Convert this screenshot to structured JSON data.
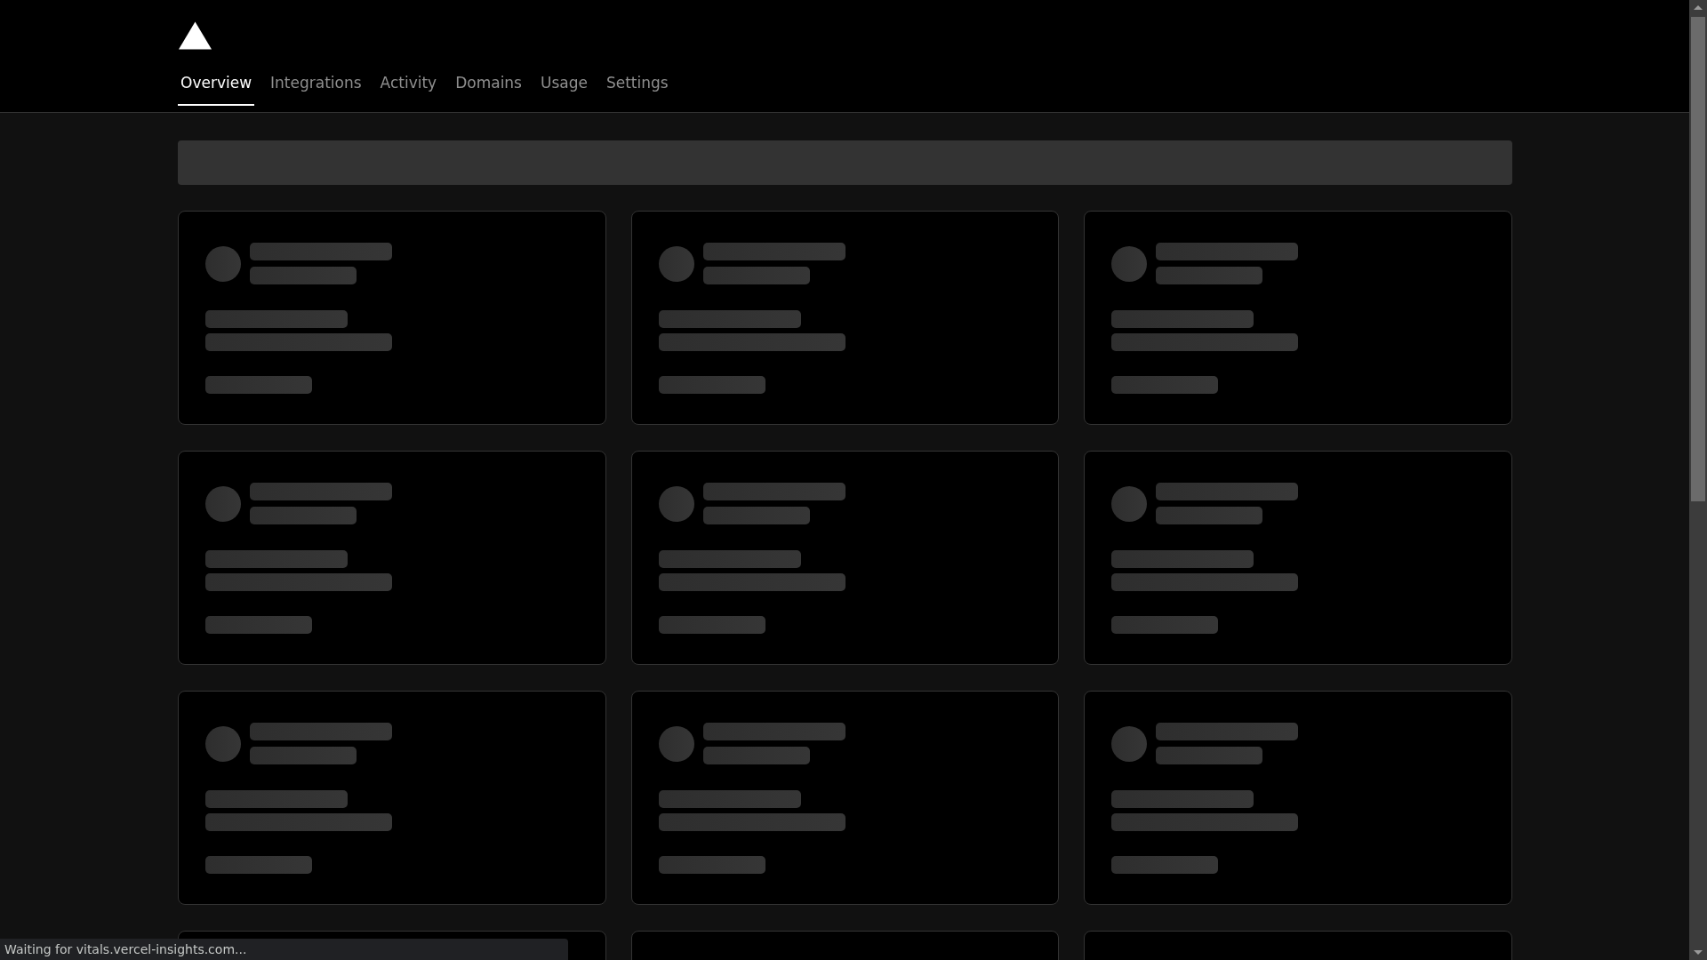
{
  "nav": {
    "tabs": [
      {
        "label": "Overview",
        "selected": true
      },
      {
        "label": "Integrations",
        "selected": false
      },
      {
        "label": "Activity",
        "selected": false
      },
      {
        "label": "Domains",
        "selected": false
      },
      {
        "label": "Usage",
        "selected": false
      },
      {
        "label": "Settings",
        "selected": false
      }
    ]
  },
  "search": {
    "kind": "skeleton"
  },
  "cards": [
    {
      "kind": "skeleton"
    },
    {
      "kind": "skeleton"
    },
    {
      "kind": "skeleton"
    },
    {
      "kind": "skeleton"
    },
    {
      "kind": "skeleton"
    },
    {
      "kind": "skeleton"
    },
    {
      "kind": "skeleton"
    },
    {
      "kind": "skeleton"
    },
    {
      "kind": "skeleton"
    },
    {
      "kind": "edge"
    },
    {
      "kind": "edge"
    },
    {
      "kind": "edge"
    }
  ],
  "status_bar": {
    "text": "Waiting for vitals.vercel-insights.com..."
  }
}
